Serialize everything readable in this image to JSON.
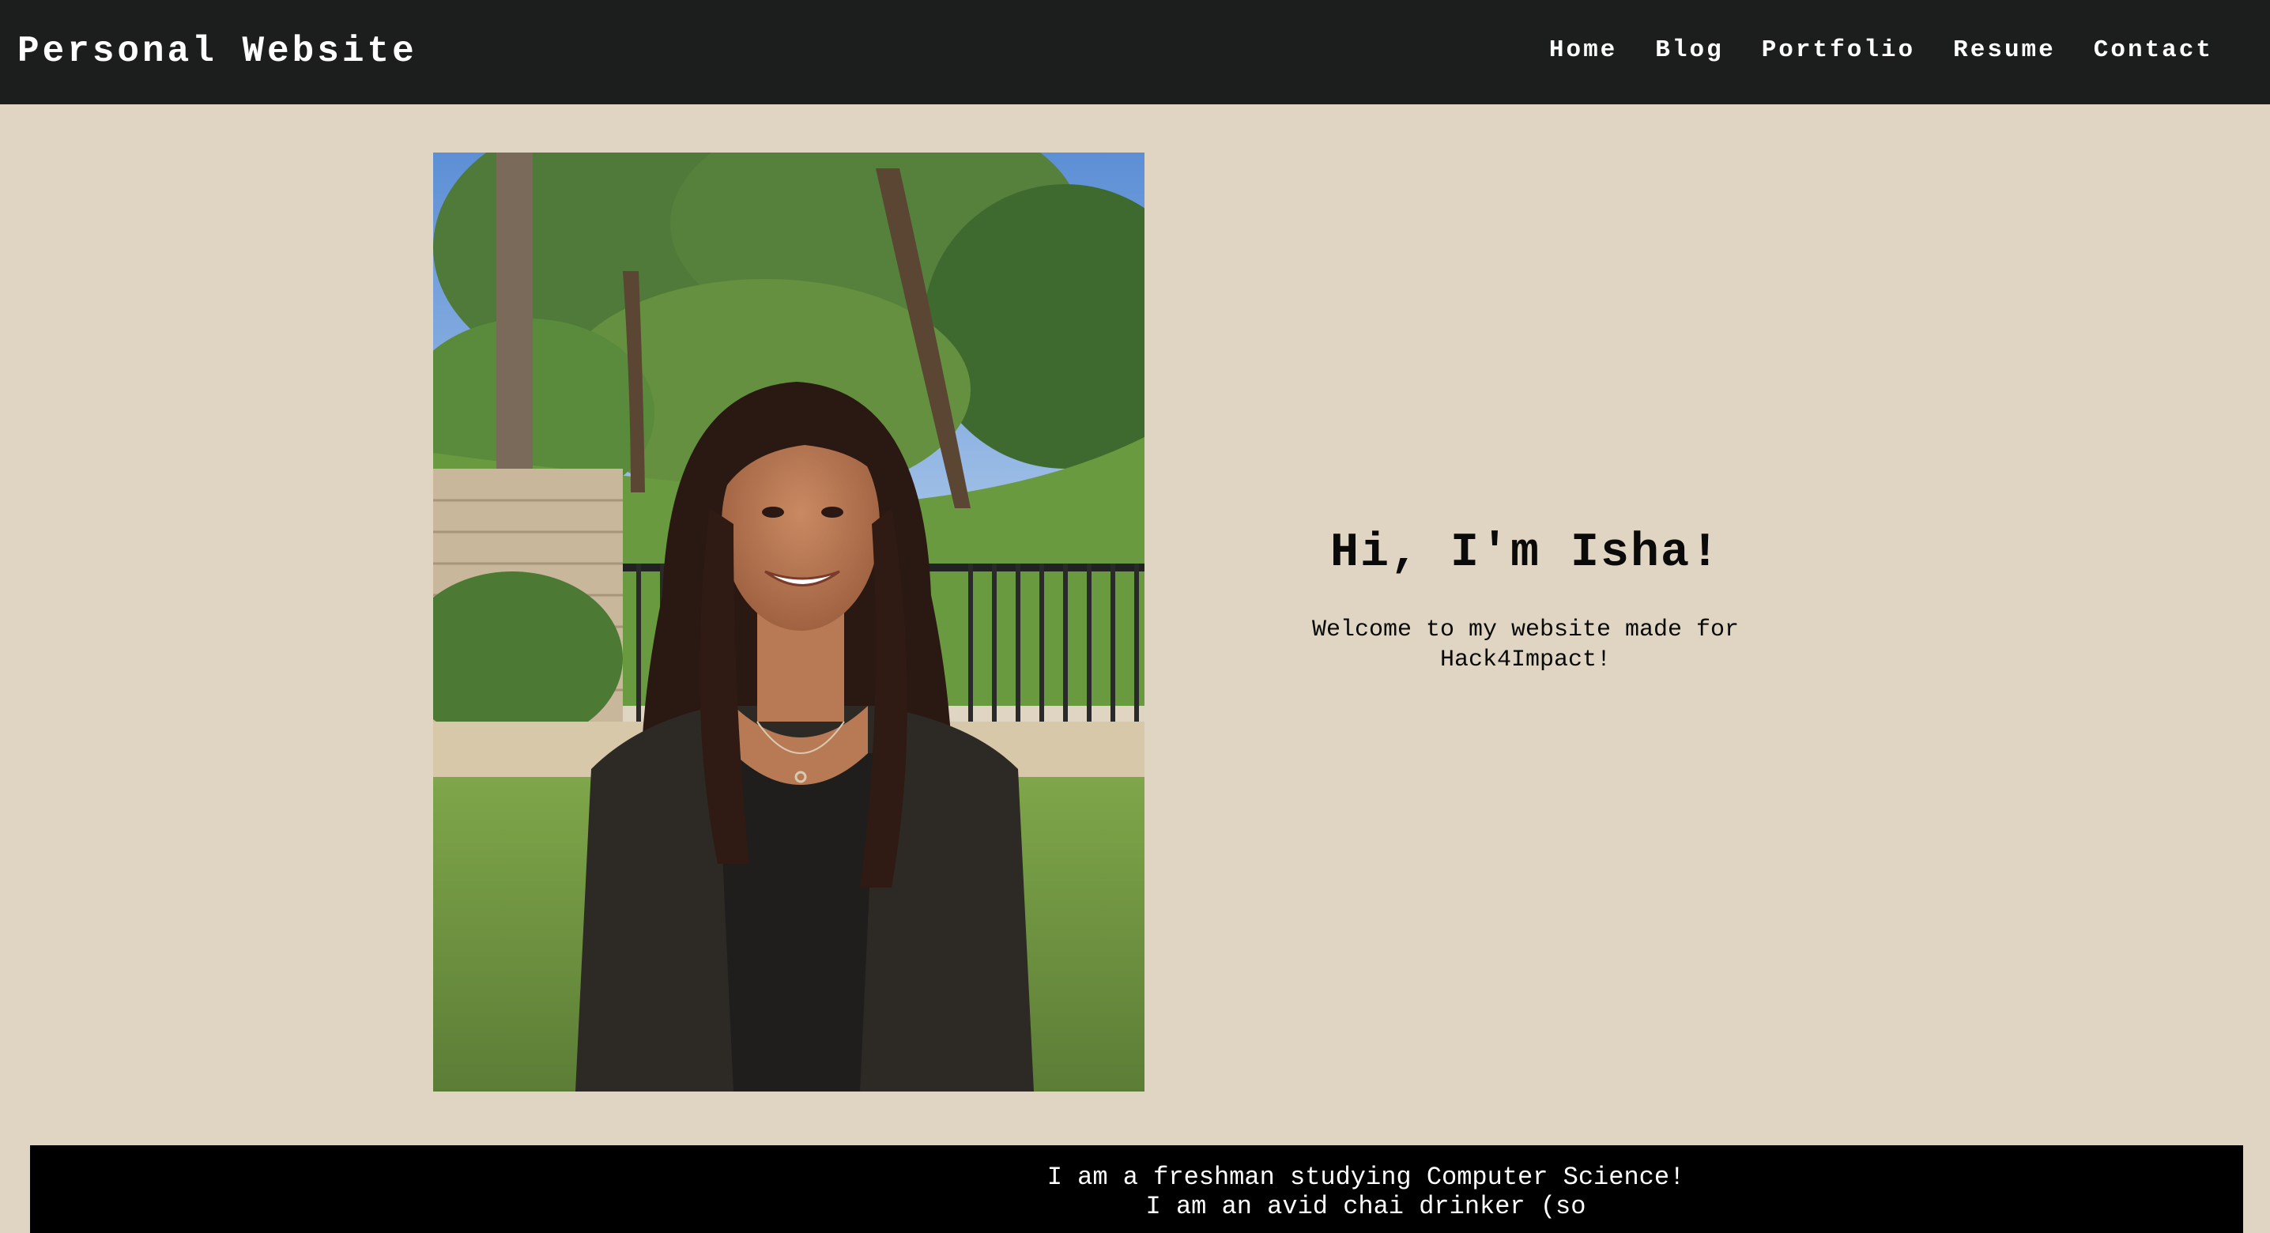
{
  "nav": {
    "brand": "Personal Website",
    "links": [
      "Home",
      "Blog",
      "Portfolio",
      "Resume",
      "Contact"
    ]
  },
  "hero": {
    "title": "Hi, I'm Isha!",
    "subtitle": "Welcome to my website made for Hack4Impact!"
  },
  "about": {
    "text": "I am a freshman studying Computer Science! I am an avid chai drinker (so"
  },
  "colors": {
    "nav_bg": "#1c1e1e",
    "page_bg": "#e0d5c3",
    "about_bg": "#000000",
    "text_light": "#ffffff",
    "text_dark": "#0a0a0a"
  }
}
